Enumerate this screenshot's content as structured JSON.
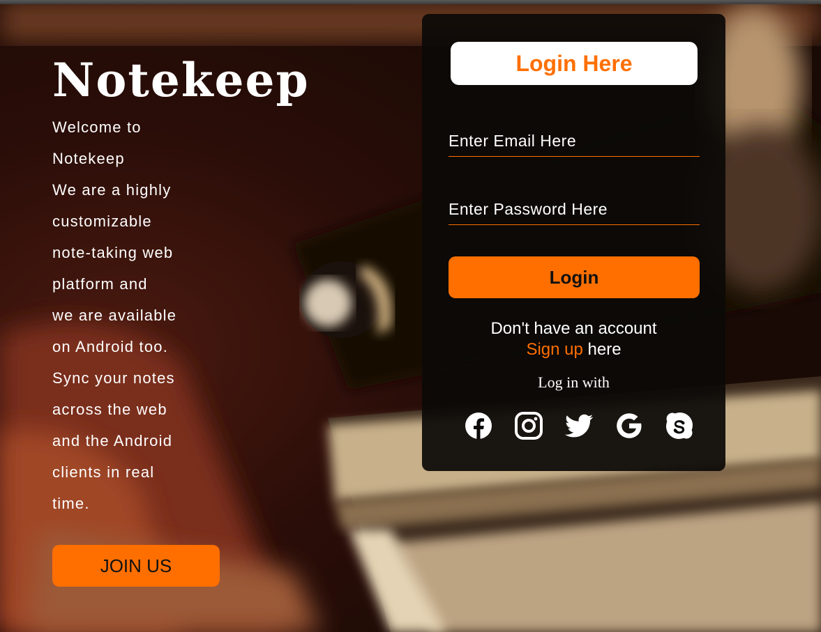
{
  "brand": {
    "title": "Notekeep"
  },
  "intro": {
    "lines": [
      "Welcome to",
      "Notekeep",
      "We are a highly",
      "customizable",
      "note-taking web",
      "platform and",
      "we are available",
      "on Android too.",
      "Sync your notes",
      "across the web",
      "and the Android",
      "clients in real",
      "time."
    ],
    "join_label": "JOIN US"
  },
  "login": {
    "title": "Login Here",
    "email_placeholder": "Enter Email Here",
    "password_placeholder": "Enter Password Here",
    "submit_label": "Login",
    "no_account_text": "Don't have an account",
    "signup_link": "Sign up",
    "signup_suffix": " here",
    "login_with": "Log in with",
    "social_icons": [
      "facebook-icon",
      "instagram-icon",
      "twitter-icon",
      "google-icon",
      "skype-icon"
    ]
  },
  "colors": {
    "accent": "#ff6f00",
    "card_bg": "#0c0a08",
    "text": "#ffffff"
  }
}
